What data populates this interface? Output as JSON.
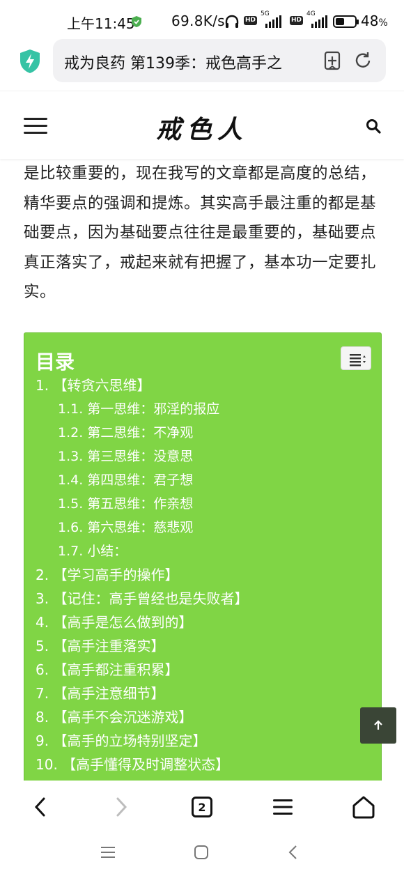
{
  "status_bar": {
    "time": "上午11:45",
    "net_speed": "69.8K/s",
    "sim1_gen": "5G",
    "sim2_gen": "4G",
    "hd_label": "HD",
    "battery_percent": "48",
    "battery_suffix": "%",
    "battery_level": 0.48,
    "accent_green": "#4caf50"
  },
  "browser": {
    "url_title": "戒为良药 第139季：戒色高手之",
    "icons": [
      "shield-icon",
      "bookmark-add-icon",
      "reload-icon"
    ]
  },
  "header": {
    "logo": "戒色人",
    "icons": [
      "menu-icon",
      "search-icon"
    ]
  },
  "article": {
    "paragraph": "是比较重要的，现在我写的文章都是高度的总结，精华要点的强调和提炼。其实高手最注重的都是基础要点，因为基础要点往往是最重要的，基础要点真正落实了，戒起来就有把握了，基本功一定要扎实。"
  },
  "toc": {
    "title": "目录",
    "bg_color": "#80d545",
    "items": [
      {
        "label": "1. 【转贪六思维】",
        "level": 1
      },
      {
        "label": "1.1. 第一思维：邪淫的报应",
        "level": 2
      },
      {
        "label": "1.2. 第二思维：不净观",
        "level": 2
      },
      {
        "label": "1.3. 第三思维：没意思",
        "level": 2
      },
      {
        "label": "1.4. 第四思维：君子想",
        "level": 2
      },
      {
        "label": "1.5. 第五思维：作亲想",
        "level": 2
      },
      {
        "label": "1.6. 第六思维：慈悲观",
        "level": 2
      },
      {
        "label": "1.7. 小结：",
        "level": 2
      },
      {
        "label": "2. 【学习高手的操作】",
        "level": 1
      },
      {
        "label": "3. 【记住：高手曾经也是失败者】",
        "level": 1
      },
      {
        "label": "4. 【高手是怎么做到的】",
        "level": 1
      },
      {
        "label": "5. 【高手注重落实】",
        "level": 1
      },
      {
        "label": "6. 【高手都注重积累】",
        "level": 1
      },
      {
        "label": "7. 【高手注意细节】",
        "level": 1
      },
      {
        "label": "8. 【高手不会沉迷游戏】",
        "level": 1
      },
      {
        "label": "9. 【高手的立场特别坚定】",
        "level": 1
      },
      {
        "label": "10. 【高手懂得及时调整状态】",
        "level": 1
      }
    ]
  },
  "bottom_toolbar": {
    "tab_count": "2",
    "icons": [
      "back-icon",
      "forward-icon",
      "tabs-icon",
      "menu-icon",
      "home-icon"
    ]
  },
  "system_nav": {
    "icons": [
      "recents-icon",
      "home-icon",
      "back-icon"
    ]
  }
}
